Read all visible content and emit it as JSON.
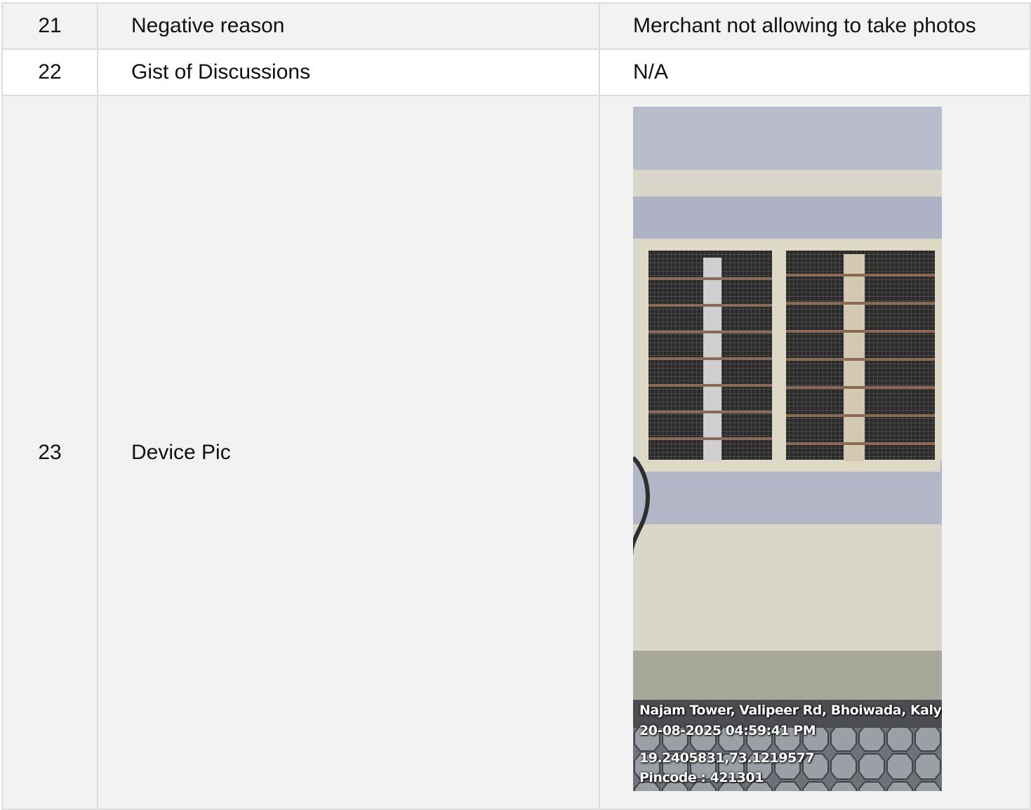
{
  "rows": [
    {
      "no": "21",
      "label": "Negative reason",
      "value": "Merchant not allowing to take photos"
    },
    {
      "no": "22",
      "label": "Gist of Discussions",
      "value": "N/A"
    },
    {
      "no": "23",
      "label": "Device Pic"
    }
  ],
  "photo": {
    "address": "Najam Tower, Valipeer Rd, Bhoiwada, Kalyan,",
    "datetime": "20-08-2025 04:59:41 PM",
    "coordinates": "19.2405831,73.1219577",
    "pincode": "Pincode : 421301"
  }
}
